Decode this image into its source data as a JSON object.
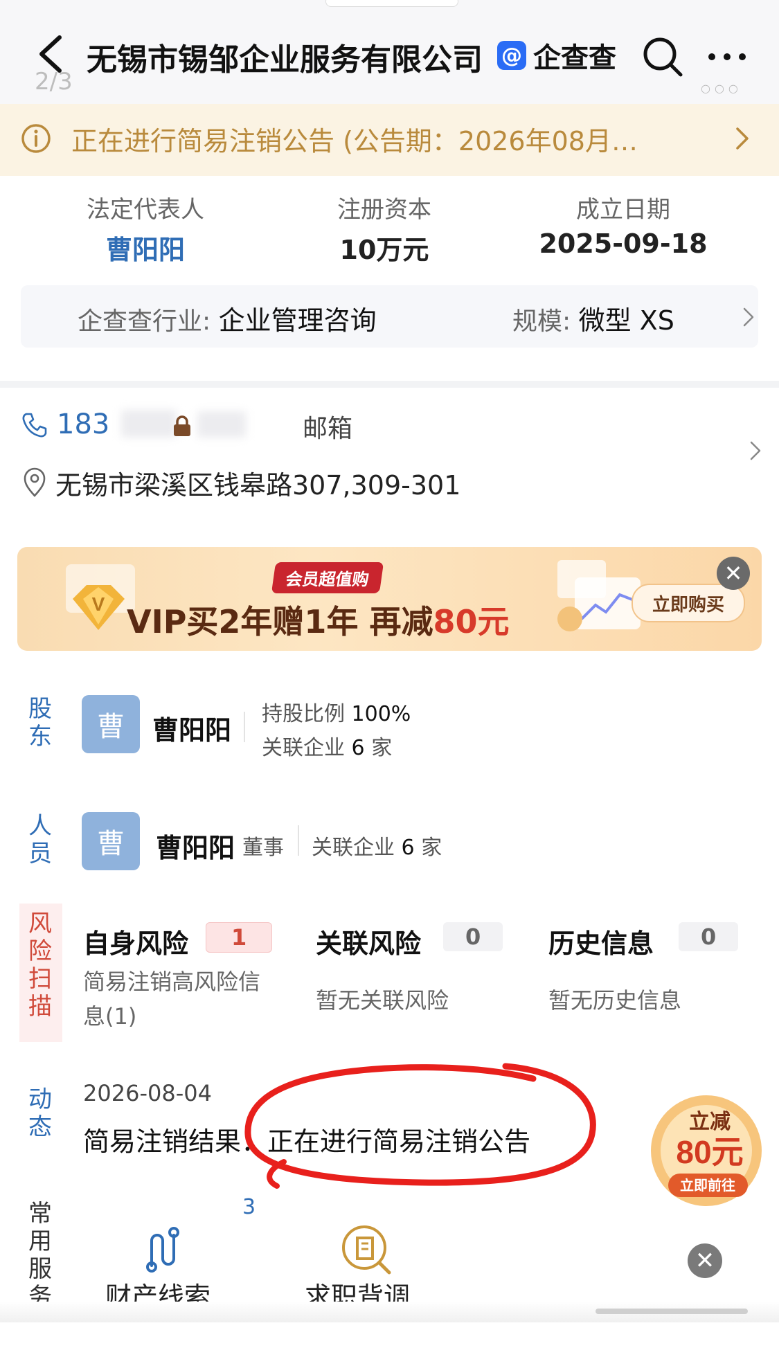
{
  "header": {
    "title": "无锡市锡邹企业服务有限公司",
    "brand_logo": "@",
    "brand_name": "企查查",
    "counter": "2/3",
    "more_icon": "ellipsis-icon",
    "search_icon": "search-icon"
  },
  "notice": {
    "text": "正在进行简易注销公告 (公告期：2026年08月…",
    "color": "#b98a3c",
    "background": "#fbf3e3"
  },
  "summary": {
    "legal_rep_label": "法定代表人",
    "legal_rep_value": "曹阳阳",
    "capital_label": "注册资本",
    "capital_value": "10万元",
    "founded_label": "成立日期",
    "founded_value": "2025-09-18",
    "industry_label": "企查查行业:",
    "industry_value": "企业管理咨询",
    "scale_label": "规模:",
    "scale_value": "微型 XS"
  },
  "contact": {
    "phone_prefix": "183",
    "email_label": "邮箱",
    "address": "无锡市梁溪区钱皋路307,309-301"
  },
  "banner": {
    "tag": "会员超值购",
    "text_a": "VIP买2年赠1年  再减",
    "text_accent": "80元",
    "cta": "立即购买",
    "close": "✕"
  },
  "shareholder": {
    "section": "股东",
    "avatar": "曹",
    "name": "曹阳阳",
    "ratio_label": "持股比例",
    "ratio_value": "100%",
    "related_label": "关联企业",
    "related_value": "6",
    "related_unit": "家"
  },
  "personnel": {
    "section": "人员",
    "avatar": "曹",
    "name": "曹阳阳",
    "role": "董事",
    "related_label": "关联企业",
    "related_value": "6",
    "related_unit": "家"
  },
  "risk": {
    "section": "风险扫描",
    "self_title": "自身风险",
    "self_count": "1",
    "self_desc_1": "简易注销高风险信",
    "self_desc_2": "息(1)",
    "related_title": "关联风险",
    "related_count": "0",
    "related_desc": "暂无关联风险",
    "history_title": "历史信息",
    "history_count": "0",
    "history_desc": "暂无历史信息"
  },
  "dynamics": {
    "section": "动态",
    "date": "2026-08-04",
    "text": "简易注销结果：正在进行简易注销公告"
  },
  "promo": {
    "line1": "立减",
    "line2": "80元",
    "line3": "立即前往"
  },
  "services": {
    "section": "常用服务",
    "count": "3",
    "item1": "财产线索",
    "item2": "求职背调",
    "close": "✕"
  }
}
